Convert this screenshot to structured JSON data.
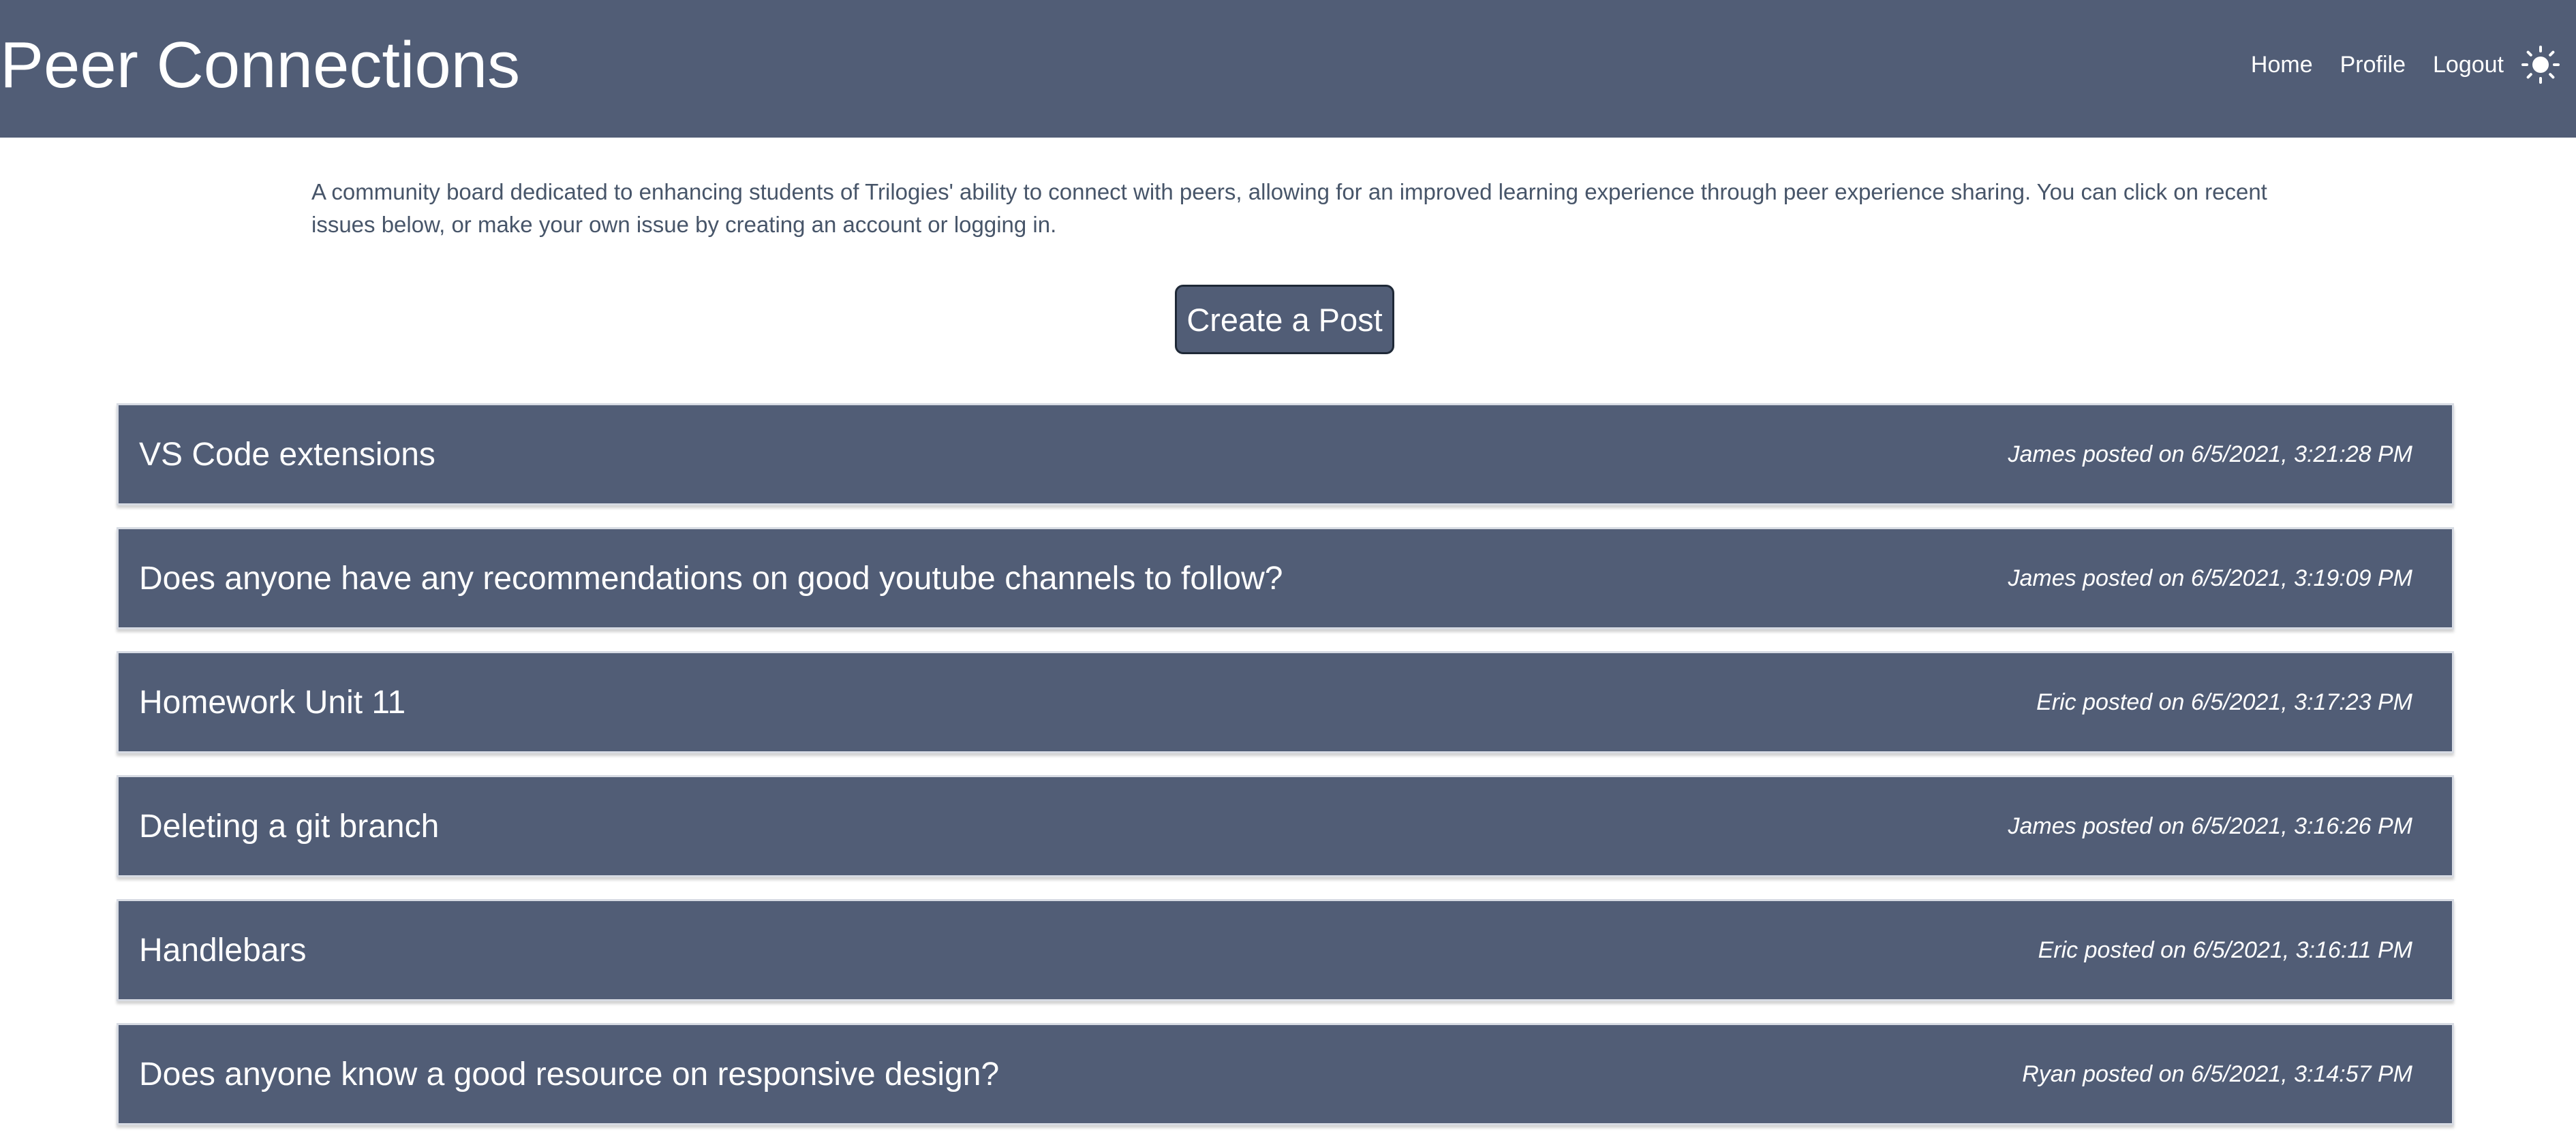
{
  "header": {
    "title": "Peer Connections",
    "nav": [
      "Home",
      "Profile",
      "Logout"
    ],
    "theme_icon": "sun-icon",
    "background_color": "#515d76"
  },
  "intro": {
    "text": "A community board dedicated to enhancing students of Trilogies' ability to connect with peers, allowing for an improved learning experience through peer experience sharing. You can click on recent issues below, or make your own issue by creating an account or logging in."
  },
  "create_button": {
    "label": "Create a Post"
  },
  "posts": [
    {
      "title": "VS Code extensions",
      "meta": "James posted on 6/5/2021, 3:21:28 PM"
    },
    {
      "title": "Does anyone have any recommendations on good youtube channels to follow?",
      "meta": "James posted on 6/5/2021, 3:19:09 PM"
    },
    {
      "title": "Homework Unit 11",
      "meta": "Eric posted on 6/5/2021, 3:17:23 PM"
    },
    {
      "title": "Deleting a git branch",
      "meta": "James posted on 6/5/2021, 3:16:26 PM"
    },
    {
      "title": "Handlebars",
      "meta": "Eric posted on 6/5/2021, 3:16:11 PM"
    },
    {
      "title": "Does anyone know a good resource on responsive design?",
      "meta": "Ryan posted on 6/5/2021, 3:14:57 PM"
    }
  ]
}
